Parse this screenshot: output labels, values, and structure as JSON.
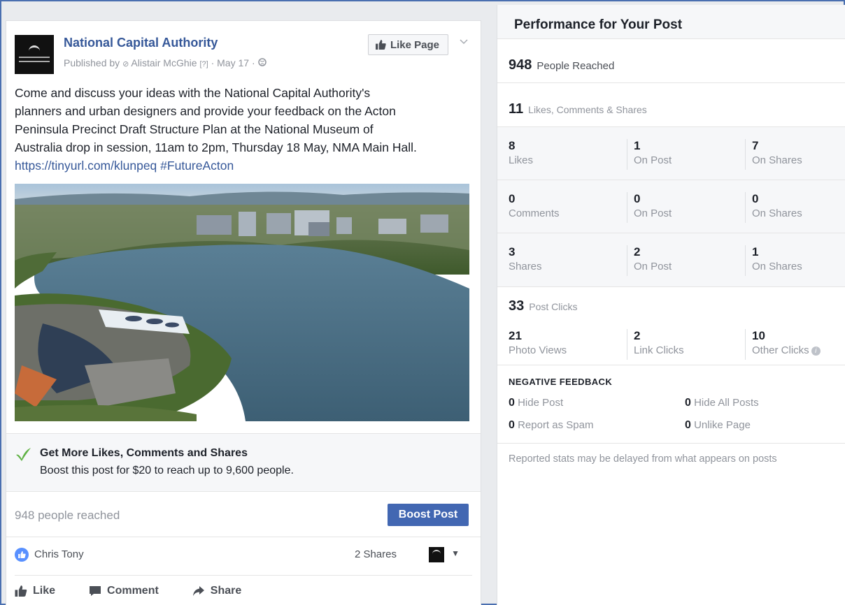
{
  "post": {
    "page_name": "National Capital Authority",
    "published_by_prefix": "Published by",
    "author": "Alistair McGhie",
    "help_marker": "[?]",
    "date": "May 17",
    "like_page_label": "Like Page",
    "text_line1": "Come and discuss your ideas with the National Capital Authority's",
    "text_line2": "planners and urban designers and provide your feedback on the Acton",
    "text_line3": "Peninsula Precinct Draft Structure Plan at the National Museum of",
    "text_line4": "Australia drop in session, 11am to 2pm, Thursday 18 May, NMA Main Hall.",
    "link": "https://tinyurl.com/klunpeq",
    "hashtag": "#FutureActon",
    "boost_promo_title": "Get More Likes, Comments and Shares",
    "boost_promo_sub": "Boost this post for $20 to reach up to 9,600 people.",
    "reach_text": "948 people reached",
    "boost_button": "Boost Post",
    "reactor_name": "Chris Tony",
    "shares_text": "2 Shares",
    "action_like": "Like",
    "action_comment": "Comment",
    "action_share": "Share"
  },
  "performance": {
    "title": "Performance for Your Post",
    "reached_num": "948",
    "reached_label": "People Reached",
    "engagement_num": "11",
    "engagement_label": "Likes, Comments & Shares",
    "rows": [
      {
        "a_num": "8",
        "a_label": "Likes",
        "b_num": "1",
        "b_label": "On Post",
        "c_num": "7",
        "c_label": "On Shares"
      },
      {
        "a_num": "0",
        "a_label": "Comments",
        "b_num": "0",
        "b_label": "On Post",
        "c_num": "0",
        "c_label": "On Shares"
      },
      {
        "a_num": "3",
        "a_label": "Shares",
        "b_num": "2",
        "b_label": "On Post",
        "c_num": "1",
        "c_label": "On Shares"
      }
    ],
    "clicks_num": "33",
    "clicks_label": "Post Clicks",
    "photo_views_num": "21",
    "photo_views_label": "Photo Views",
    "link_clicks_num": "2",
    "link_clicks_label": "Link Clicks",
    "other_clicks_num": "10",
    "other_clicks_label": "Other Clicks",
    "negative_title": "NEGATIVE FEEDBACK",
    "hide_post_num": "0",
    "hide_post_label": "Hide Post",
    "hide_all_num": "0",
    "hide_all_label": "Hide All Posts",
    "spam_num": "0",
    "spam_label": "Report as Spam",
    "unlike_num": "0",
    "unlike_label": "Unlike Page",
    "footer_note": "Reported stats may be delayed from what appears on posts"
  },
  "icons": {
    "globe": "globe-icon",
    "like": "thumbs-up-icon",
    "check": "check-leaf-icon",
    "comment": "comment-icon",
    "share": "share-arrow-icon"
  },
  "colors": {
    "link_blue": "#365899",
    "boost_blue": "#4267b2",
    "promo_green": "#5fb244"
  }
}
